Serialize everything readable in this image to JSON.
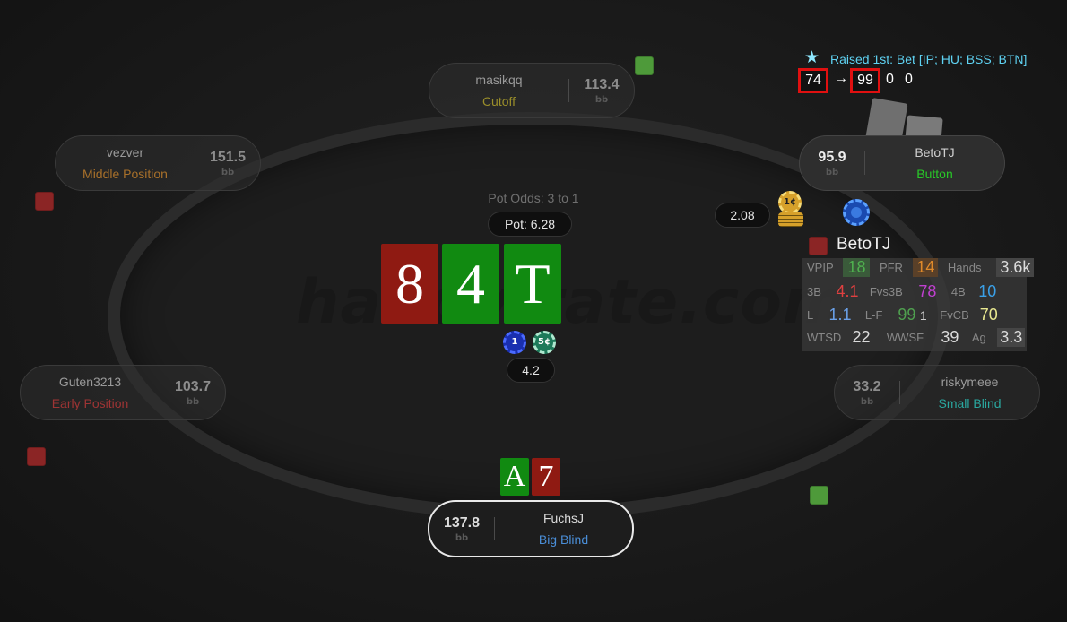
{
  "watermark": "handvirate.com",
  "seats": {
    "cutoff": {
      "name": "masikqq",
      "position": "Cutoff",
      "stack": "113.4",
      "unit": "bb",
      "position_color": "#9a8e2a"
    },
    "middle": {
      "name": "vezver",
      "position": "Middle Position",
      "stack": "151.5",
      "unit": "bb",
      "position_color": "#a8702a"
    },
    "early": {
      "name": "Guten3213",
      "position": "Early Position",
      "stack": "103.7",
      "unit": "bb",
      "position_color": "#9e3434"
    },
    "button": {
      "name": "BetoTJ",
      "position": "Button",
      "stack": "95.9",
      "unit": "bb",
      "position_color": "#28c828"
    },
    "small_blind": {
      "name": "riskymeee",
      "position": "Small Blind",
      "stack": "33.2",
      "unit": "bb",
      "position_color": "#2aa8a0"
    },
    "big_blind": {
      "name": "FuchsJ",
      "position": "Big Blind",
      "stack": "137.8",
      "unit": "bb",
      "position_color": "#4a8ed8"
    }
  },
  "pot": {
    "odds": "Pot Odds: 3 to 1",
    "label": "Pot: 6.28"
  },
  "board": [
    {
      "rank": "8",
      "suit": "red-heart-diamond"
    },
    {
      "rank": "4",
      "suit": "green-club"
    },
    {
      "rank": "T",
      "suit": "green-club"
    }
  ],
  "hero_hand": [
    {
      "rank": "A",
      "suit": "green-club"
    },
    {
      "rank": "7",
      "suit": "red-heart-diamond"
    }
  ],
  "bets": {
    "button_bet": "2.08",
    "center_bet": "4.2"
  },
  "chips": {
    "button_chip": "1¢",
    "center_chip_1": "1",
    "center_chip_2": "5¢"
  },
  "hud": {
    "player": "BetoTJ",
    "rows": [
      [
        {
          "label": "VPIP",
          "value": "18",
          "color": "#4fb04f",
          "bg": "#3a5a3a"
        },
        {
          "label": "PFR",
          "value": "14",
          "color": "#e08a2a",
          "bg": "#5a4028"
        },
        {
          "label": "Hands",
          "value": "3.6k",
          "color": "#dcdcdc"
        }
      ],
      [
        {
          "label": "3B",
          "value": "4.1",
          "color": "#e04040"
        },
        {
          "label": "Fvs3B",
          "value": "78",
          "color": "#c040d0"
        },
        {
          "label": "4B",
          "value": "10",
          "color": "#3aa0e8"
        }
      ],
      [
        {
          "label": "L",
          "value": "1.1",
          "color": "#6aa0e8"
        },
        {
          "label": "L-F",
          "value": "99",
          "color": "#4fa04f",
          "extra": "1"
        },
        {
          "label": "FvCB",
          "value": "70",
          "color": "#e8e890"
        }
      ],
      [
        {
          "label": "WTSD",
          "value": "22",
          "color": "#dcdcdc"
        },
        {
          "label": "WWSF",
          "value": "39",
          "color": "#dcdcdc"
        },
        {
          "label": "Ag",
          "value": "3.3",
          "color": "#dcdcdc"
        }
      ]
    ]
  },
  "bet_tracker": {
    "title": "Raised 1st: Bet [IP; HU; BSS; BTN]",
    "from": "74",
    "arrow": "→",
    "to": "99",
    "n1": "0",
    "n2": "0"
  },
  "colors": {
    "red_card": "#8f1a12",
    "green_card": "#118a11",
    "hud_red_square": "#8b2525",
    "marker_green": "#4e9a3a",
    "marker_red": "#8b2525"
  }
}
